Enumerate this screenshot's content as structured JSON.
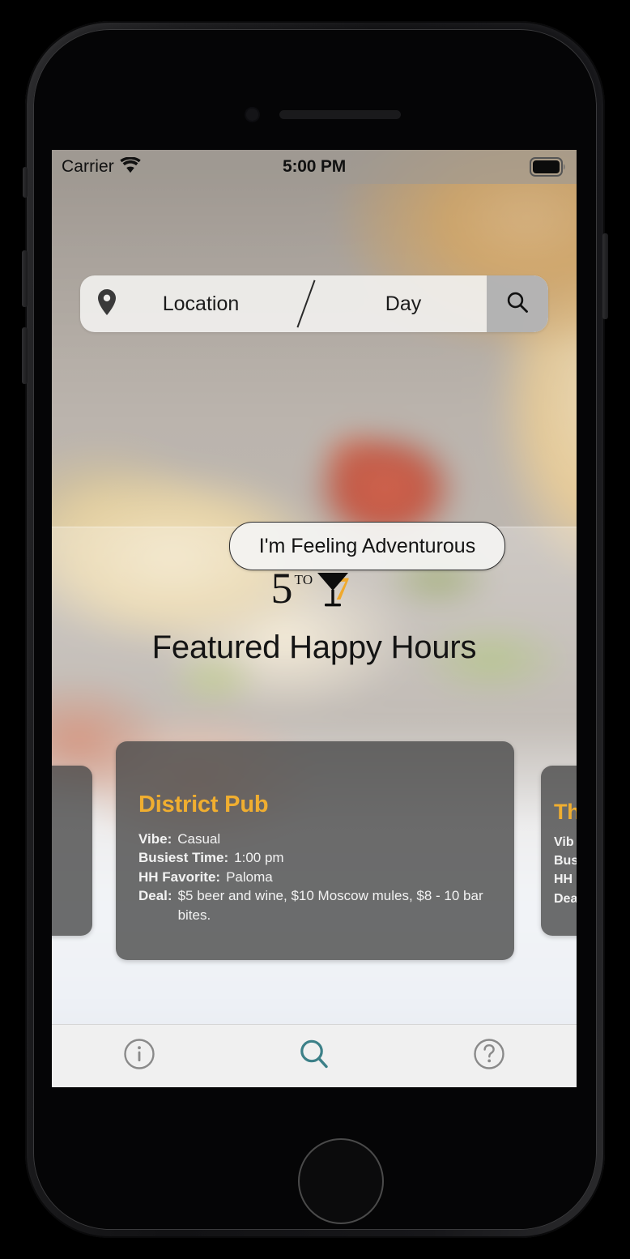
{
  "status_bar": {
    "carrier": "Carrier",
    "time": "5:00 PM",
    "wifi_icon": "wifi-icon",
    "battery_icon": "battery-full-icon"
  },
  "search": {
    "pin_icon": "location-pin-icon",
    "location_placeholder": "Location",
    "day_placeholder": "Day",
    "divider": "/",
    "submit_icon": "search-icon"
  },
  "adventurous": {
    "label": "I'm Feeling Adventurous"
  },
  "brand": {
    "five": "5",
    "to": "TO",
    "seven": "7",
    "glass_icon": "martini-glass-icon",
    "accent_color": "#f0a92c"
  },
  "featured": {
    "heading": "Featured Happy Hours"
  },
  "labels": {
    "vibe": "Vibe:",
    "busiest_time": "Busiest Time:",
    "hh_favorite": "HH Favorite:",
    "deal": "Deal:"
  },
  "cards": {
    "main": {
      "title": "District Pub",
      "vibe": "Casual",
      "busiest_time": "1:00 pm",
      "hh_favorite": "Paloma",
      "deal": "$5 beer and wine, $10 Moscow mules, $8 - 10 bar bites.",
      "title_color": "#f0ae30"
    },
    "next": {
      "title": "Th",
      "vibe_label": "Vib",
      "busiest_label": "Bus",
      "hh_label": "HH",
      "deal_label": "Dea"
    }
  },
  "tab_bar": {
    "items": [
      {
        "name": "info",
        "icon": "info-circle-icon",
        "active": false
      },
      {
        "name": "search",
        "icon": "search-icon",
        "active": true
      },
      {
        "name": "help",
        "icon": "question-circle-icon",
        "active": false
      }
    ],
    "active_color": "#3c8088",
    "inactive_color": "#8a8a8a"
  }
}
